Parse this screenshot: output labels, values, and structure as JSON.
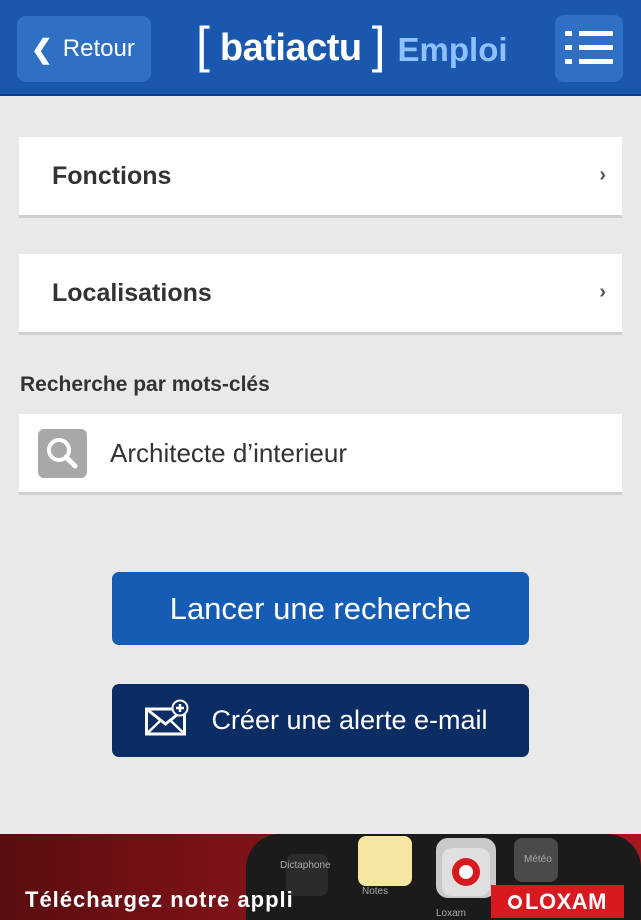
{
  "header": {
    "back_label": "Retour",
    "brand_name": "batiactu",
    "brand_section": "Emploi",
    "colors": {
      "bar": "#1a58b0",
      "button": "#2f6fc4",
      "section": "#8fc0ff"
    }
  },
  "filters": [
    {
      "label": "Fonctions"
    },
    {
      "label": "Localisations"
    }
  ],
  "keywords": {
    "section_label": "Recherche par mots-clés",
    "value": "Architecte d’interieur"
  },
  "actions": {
    "search_label": "Lancer une recherche",
    "alert_label": "Créer une alerte e-mail"
  },
  "banner": {
    "text": "Téléchargez notre appli",
    "brand": "LOXAM",
    "app_labels": [
      "Dictaphone",
      "Notes",
      "Météo",
      "Loxam"
    ]
  },
  "icons": [
    "chevron-left-icon",
    "hamburger-menu-icon",
    "chevron-right-icon",
    "search-icon",
    "mail-add-icon"
  ]
}
